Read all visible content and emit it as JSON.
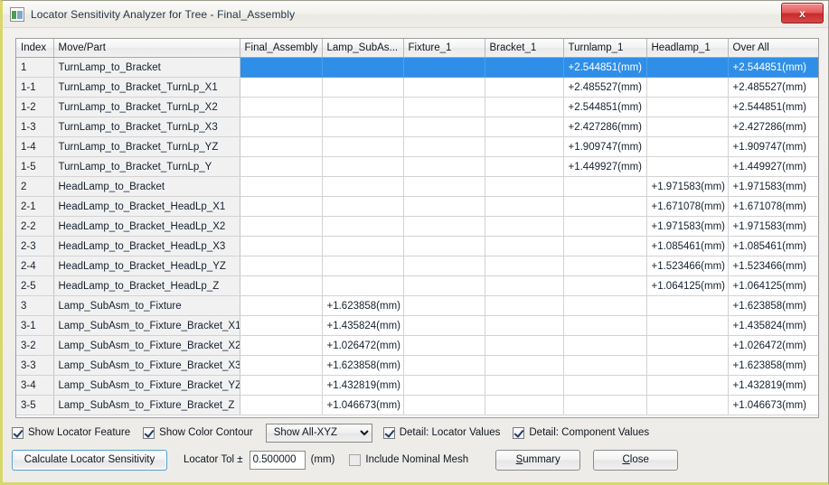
{
  "window": {
    "title": "Locator Sensitivity Analyzer for Tree - Final_Assembly",
    "icon": "window-panel-icon",
    "close_label": "x",
    "accent_blue": "#2f8fe8",
    "close_red": "#c92a2a"
  },
  "table": {
    "columns": [
      "Index",
      "Move/Part",
      "Final_Assembly",
      "Lamp_SubAs...",
      "Fixture_1",
      "Bracket_1",
      "Turnlamp_1",
      "Headlamp_1",
      "Over All"
    ],
    "selected_row_index": 0,
    "rows": [
      {
        "index": "1",
        "name": "TurnLamp_to_Bracket",
        "values": [
          "",
          "",
          "",
          "",
          "+2.544851(mm)",
          "",
          "+2.544851(mm)"
        ],
        "selected": true
      },
      {
        "index": "1-1",
        "name": "TurnLamp_to_Bracket_TurnLp_X1",
        "values": [
          "",
          "",
          "",
          "",
          "+2.485527(mm)",
          "",
          "+2.485527(mm)"
        ]
      },
      {
        "index": "1-2",
        "name": "TurnLamp_to_Bracket_TurnLp_X2",
        "values": [
          "",
          "",
          "",
          "",
          "+2.544851(mm)",
          "",
          "+2.544851(mm)"
        ]
      },
      {
        "index": "1-3",
        "name": "TurnLamp_to_Bracket_TurnLp_X3",
        "values": [
          "",
          "",
          "",
          "",
          "+2.427286(mm)",
          "",
          "+2.427286(mm)"
        ]
      },
      {
        "index": "1-4",
        "name": "TurnLamp_to_Bracket_TurnLp_YZ",
        "values": [
          "",
          "",
          "",
          "",
          "+1.909747(mm)",
          "",
          "+1.909747(mm)"
        ]
      },
      {
        "index": "1-5",
        "name": "TurnLamp_to_Bracket_TurnLp_Y",
        "values": [
          "",
          "",
          "",
          "",
          "+1.449927(mm)",
          "",
          "+1.449927(mm)"
        ]
      },
      {
        "index": "2",
        "name": "HeadLamp_to_Bracket",
        "values": [
          "",
          "",
          "",
          "",
          "",
          "+1.971583(mm)",
          "+1.971583(mm)"
        ]
      },
      {
        "index": "2-1",
        "name": "HeadLamp_to_Bracket_HeadLp_X1",
        "values": [
          "",
          "",
          "",
          "",
          "",
          "+1.671078(mm)",
          "+1.671078(mm)"
        ]
      },
      {
        "index": "2-2",
        "name": "HeadLamp_to_Bracket_HeadLp_X2",
        "values": [
          "",
          "",
          "",
          "",
          "",
          "+1.971583(mm)",
          "+1.971583(mm)"
        ]
      },
      {
        "index": "2-3",
        "name": "HeadLamp_to_Bracket_HeadLp_X3",
        "values": [
          "",
          "",
          "",
          "",
          "",
          "+1.085461(mm)",
          "+1.085461(mm)"
        ]
      },
      {
        "index": "2-4",
        "name": "HeadLamp_to_Bracket_HeadLp_YZ",
        "values": [
          "",
          "",
          "",
          "",
          "",
          "+1.523466(mm)",
          "+1.523466(mm)"
        ]
      },
      {
        "index": "2-5",
        "name": "HeadLamp_to_Bracket_HeadLp_Z",
        "values": [
          "",
          "",
          "",
          "",
          "",
          "+1.064125(mm)",
          "+1.064125(mm)"
        ]
      },
      {
        "index": "3",
        "name": "Lamp_SubAsm_to_Fixture",
        "values": [
          "",
          "+1.623858(mm)",
          "",
          "",
          "",
          "",
          "+1.623858(mm)"
        ]
      },
      {
        "index": "3-1",
        "name": "Lamp_SubAsm_to_Fixture_Bracket_X1",
        "values": [
          "",
          "+1.435824(mm)",
          "",
          "",
          "",
          "",
          "+1.435824(mm)"
        ]
      },
      {
        "index": "3-2",
        "name": "Lamp_SubAsm_to_Fixture_Bracket_X2",
        "values": [
          "",
          "+1.026472(mm)",
          "",
          "",
          "",
          "",
          "+1.026472(mm)"
        ]
      },
      {
        "index": "3-3",
        "name": "Lamp_SubAsm_to_Fixture_Bracket_X3",
        "values": [
          "",
          "+1.623858(mm)",
          "",
          "",
          "",
          "",
          "+1.623858(mm)"
        ]
      },
      {
        "index": "3-4",
        "name": "Lamp_SubAsm_to_Fixture_Bracket_YZ",
        "values": [
          "",
          "+1.432819(mm)",
          "",
          "",
          "",
          "",
          "+1.432819(mm)"
        ]
      },
      {
        "index": "3-5",
        "name": "Lamp_SubAsm_to_Fixture_Bracket_Z",
        "values": [
          "",
          "+1.046673(mm)",
          "",
          "",
          "",
          "",
          "+1.046673(mm)"
        ]
      }
    ]
  },
  "controls": {
    "show_locator_feature": {
      "label": "Show Locator Feature",
      "checked": true
    },
    "show_color_contour": {
      "label": "Show Color Contour",
      "checked": true
    },
    "view_mode": {
      "selected": "Show All-XYZ",
      "options": [
        "Show All-XYZ"
      ]
    },
    "detail_locator_values": {
      "label": "Detail: Locator Values",
      "checked": true
    },
    "detail_component_values": {
      "label": "Detail: Component Values",
      "checked": true
    },
    "calculate_button": "Calculate Locator Sensitivity",
    "tol_label": "Locator Tol ±",
    "tol_value": "0.500000",
    "tol_unit": "(mm)",
    "include_nominal_mesh": {
      "label": "Include Nominal Mesh",
      "checked": false
    },
    "summary_button": {
      "prefix": "",
      "accel": "S",
      "suffix": "ummary"
    },
    "close_button": {
      "prefix": "",
      "accel": "C",
      "suffix": "lose"
    }
  }
}
